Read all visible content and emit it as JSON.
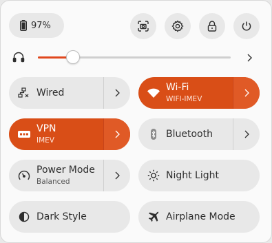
{
  "battery": {
    "percent": "97%"
  },
  "top_buttons": [
    {
      "name": "screenshot-icon"
    },
    {
      "name": "settings-icon"
    },
    {
      "name": "lock-icon"
    },
    {
      "name": "power-icon"
    }
  ],
  "volume": {
    "icon": "headphones-icon",
    "level_percent": 18
  },
  "tiles": {
    "wired": {
      "title": "Wired",
      "active": false
    },
    "wifi": {
      "title": "Wi-Fi",
      "subtitle": "WIFI-IMEV",
      "active": true
    },
    "vpn": {
      "title": "VPN",
      "subtitle": "IMEV",
      "active": true
    },
    "bluetooth": {
      "title": "Bluetooth",
      "active": false
    },
    "power_mode": {
      "title": "Power Mode",
      "subtitle": "Balanced",
      "active": false
    },
    "night_light": {
      "title": "Night Light",
      "active": false
    },
    "dark_style": {
      "title": "Dark Style",
      "active": false
    },
    "airplane_mode": {
      "title": "Airplane Mode",
      "active": false
    }
  },
  "colors": {
    "accent": "#d94e17",
    "tile_bg": "#e8e8e8",
    "panel_bg": "#fafafa"
  }
}
